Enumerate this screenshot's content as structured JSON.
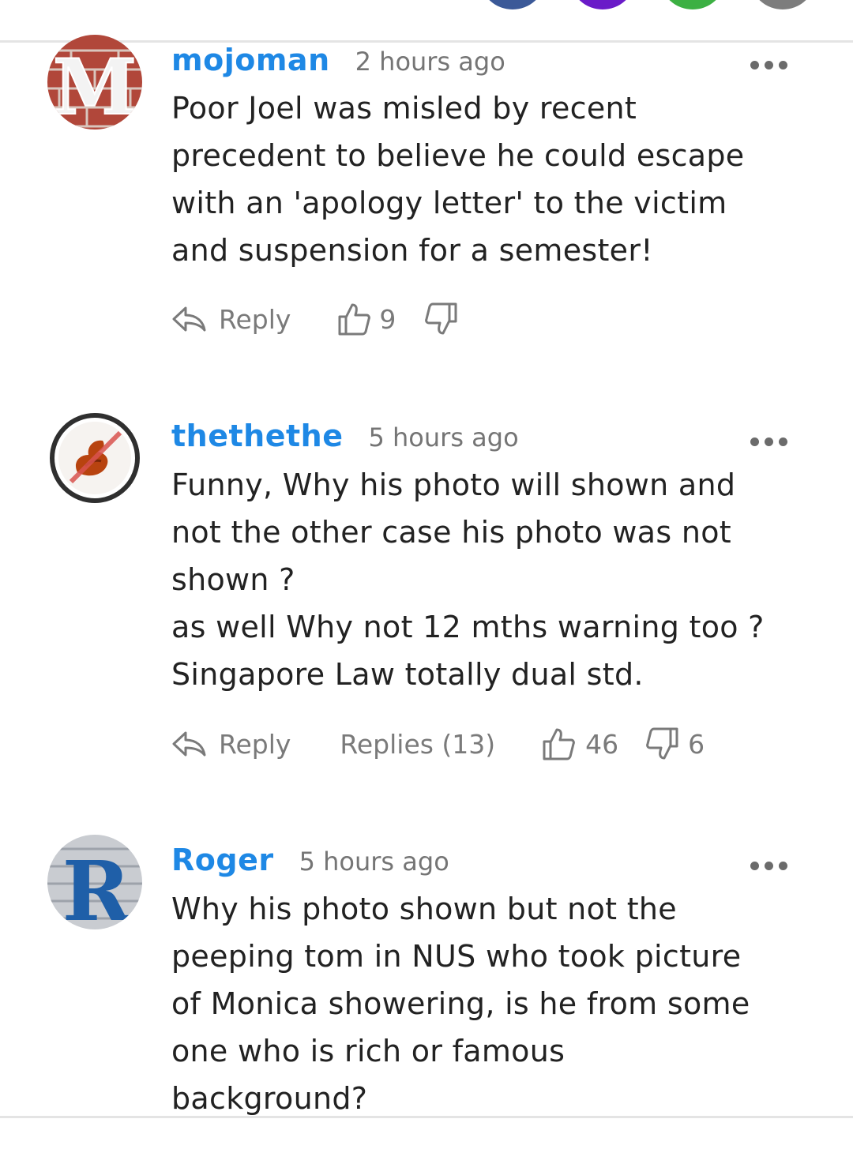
{
  "comments": [
    {
      "username": "mojoman",
      "time": "2 hours ago",
      "avatar_letter": "M",
      "text": "Poor Joel was misled by recent\nprecedent to believe he could escape\nwith an 'apology letter' to the victim\nand suspension for a semester!",
      "reply_label": "Reply",
      "likes": "9"
    },
    {
      "username": "thethethe",
      "time": "5 hours ago",
      "text": "Funny, Why his photo will shown and\nnot the other case his photo was not\nshown ?\nas well Why not 12 mths warning too ?\nSingapore Law totally dual std.",
      "reply_label": "Reply",
      "replies_label": "Replies (13)",
      "likes": "46",
      "dislikes": "6"
    },
    {
      "username": "Roger",
      "time": "5 hours ago",
      "avatar_letter": "R",
      "text": "Why his photo shown but not the\npeeping tom in NUS who took picture\nof Monica showering, is he from some\none who is rich or famous\nbackground?"
    }
  ],
  "share_colors": [
    "#3b5998",
    "#6a1bc8",
    "#3cb043",
    "#7d7d7d"
  ],
  "colors": {
    "username": "#1e88e5",
    "muted": "#757575",
    "text": "#222222"
  }
}
